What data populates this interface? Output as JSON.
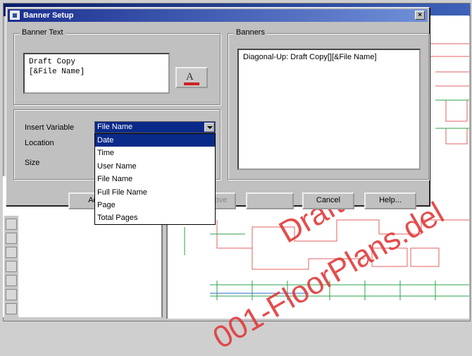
{
  "dialog": {
    "title": "Banner Setup",
    "close_glyph": "×",
    "banner_text_group_label": "Banner Text",
    "banner_text_lines": [
      "Draft Copy",
      "[&File Name]"
    ],
    "font_button_glyph": "A",
    "banners_group_label": "Banners",
    "banners_list": [
      "Diagonal-Up: Draft Copy[][&File Name]"
    ],
    "insert_variable_label": "Insert Variable",
    "insert_variable_value": "File Name",
    "location_label": "Location",
    "size_label": "Size",
    "dropdown_options": [
      "Date",
      "Time",
      "User Name",
      "File Name",
      "Full File Name",
      "Page",
      "Total Pages"
    ],
    "selected_option_index": 0,
    "buttons": {
      "add_label": "Add",
      "remove_label": "Remove",
      "cancel_label": "Cancel",
      "help_label": "Help..."
    }
  },
  "watermark": {
    "line1": "Draft Copy",
    "line2": "001-FloorPlans.del",
    "color": "#e23a3a"
  },
  "colors": {
    "title_bar": "#1a2f90",
    "selection": "#0a2a8a",
    "dialog_face": "#c0c0c0"
  }
}
